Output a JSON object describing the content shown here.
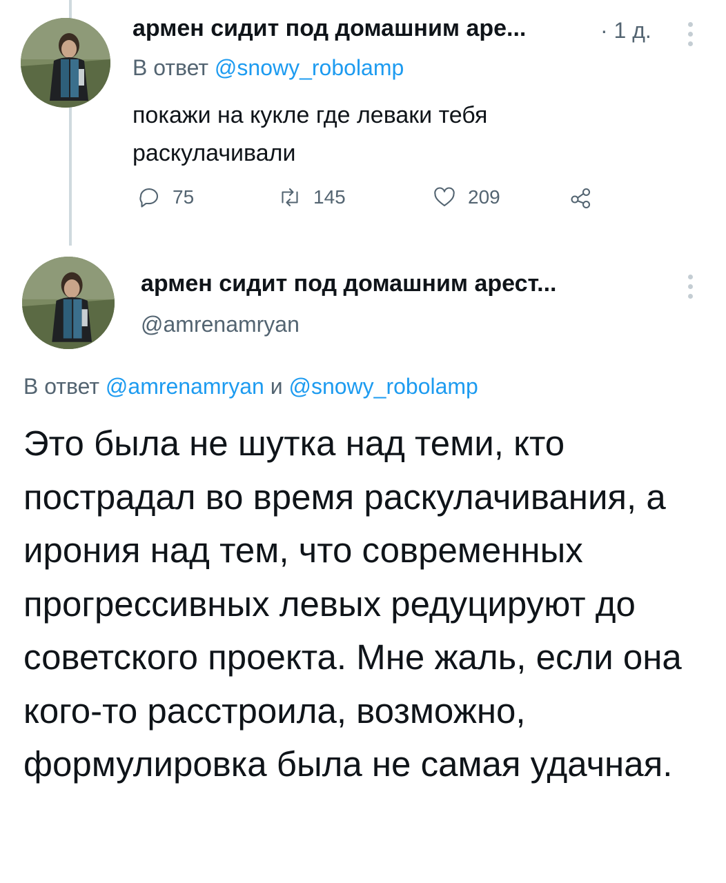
{
  "reply_tweet": {
    "author_name": "армен сидит под домашним аре...",
    "time": "· 1 д.",
    "reply_prefix": "В ответ ",
    "reply_handle": "@snowy_robolamp",
    "text": "покажи на кукле где леваки тебя раскулачивали",
    "actions": {
      "reply_count": "75",
      "retweet_count": "145",
      "like_count": "209"
    }
  },
  "main_tweet": {
    "author_name": "армен сидит под домашним арест...",
    "handle": "@amrenamryan",
    "reply_prefix": "В ответ ",
    "reply_handle_1": "@amrenamryan",
    "reply_joiner": " и ",
    "reply_handle_2": "@snowy_robolamp",
    "text": "Это была не шутка над теми, кто пострадал во время раскулачивания, а ирония над тем, что современных прогрессивных левых редуцируют до советского проекта. Мне жаль, если она кого-то расстроила, возможно, формулировка была не самая удачная."
  },
  "colors": {
    "text": "#0f1419",
    "secondary": "#536471",
    "link": "#1d9bf0",
    "thread_line": "#cfd9de"
  },
  "icons": [
    "avatar",
    "more-icon",
    "reply-icon",
    "retweet-icon",
    "like-icon",
    "share-icon"
  ]
}
